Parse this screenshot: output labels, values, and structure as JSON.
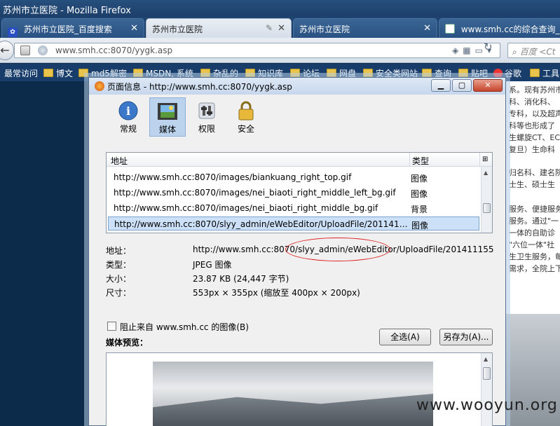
{
  "window": {
    "title": "苏州市立医院 - Mozilla Firefox"
  },
  "tabs": [
    {
      "label": "苏州市立医院_百度搜索"
    },
    {
      "label": "苏州市立医院"
    },
    {
      "label": "苏州市立医院"
    },
    {
      "label": "www.smh.cc的综合查询_"
    }
  ],
  "navbar": {
    "url": "www.smh.cc:8070/yygk.asp",
    "search_placeholder": "百度 <Ct"
  },
  "bookmarks": [
    {
      "label": "最常访问"
    },
    {
      "label": "博文"
    },
    {
      "label": "md5解密"
    },
    {
      "label": "MSDN, 系统"
    },
    {
      "label": "杂乱的"
    },
    {
      "label": "知识库"
    },
    {
      "label": "论坛"
    },
    {
      "label": "网盘"
    },
    {
      "label": "安全类网站"
    },
    {
      "label": "查询"
    },
    {
      "label": "贴吧"
    },
    {
      "label": "谷歌"
    },
    {
      "label": "工具"
    }
  ],
  "page_fragments": [
    "系。现有苏州市",
    "科、消化科、",
    "专科，以及超声",
    "科等也形成了",
    "生螺旋CT、EC",
    "复旦）生命科",
    "归名科、建名院",
    "士生、硕士生",
    "服务、便捷服务",
    "服务。通过\"一",
    "一体的自助诊",
    "\"六位一体\"社",
    "生卫生服务，每",
    "需求，全院上下"
  ],
  "dialog": {
    "title": "页面信息 - http://www.smh.cc:8070/yygk.asp",
    "toolbar": [
      {
        "label": "常规",
        "icon": "info-icon"
      },
      {
        "label": "媒体",
        "icon": "media-icon"
      },
      {
        "label": "权限",
        "icon": "permissions-icon"
      },
      {
        "label": "安全",
        "icon": "lock-icon"
      }
    ],
    "list": {
      "col_address": "地址",
      "col_type": "类型",
      "rows": [
        {
          "address": "http://www.smh.cc:8070/images/biankuang_right_top.gif",
          "type": "图像"
        },
        {
          "address": "http://www.smh.cc:8070/images/nei_biaoti_right_middle_left_bg.gif",
          "type": "图像"
        },
        {
          "address": "http://www.smh.cc:8070/images/nei_biaoti_right_middle_bg.gif",
          "type": "背景"
        },
        {
          "address": "http://www.smh.cc:8070/slyy_admin/eWebEditor/UploadFile/20114111...",
          "type": "图像",
          "selected": true
        }
      ]
    },
    "details": {
      "address_label": "地址：",
      "address_value": "http://www.smh.cc:8070/slyy_admin/eWebEditor/UploadFile/201411155",
      "type_label": "类型：",
      "type_value": "JPEG 图像",
      "size_label": "大小：",
      "size_value": "23.87 KB (24,447 字节)",
      "dims_label": "尺寸：",
      "dims_value": "553px × 355px (缩放至 400px × 200px)"
    },
    "block_checkbox_label": "阻止来自 www.smh.cc 的图像(B)",
    "select_all_button": "全选(A)",
    "save_as_button": "另存为(A)...",
    "preview_label": "媒体预览："
  },
  "watermark": "www.wooyun.org"
}
